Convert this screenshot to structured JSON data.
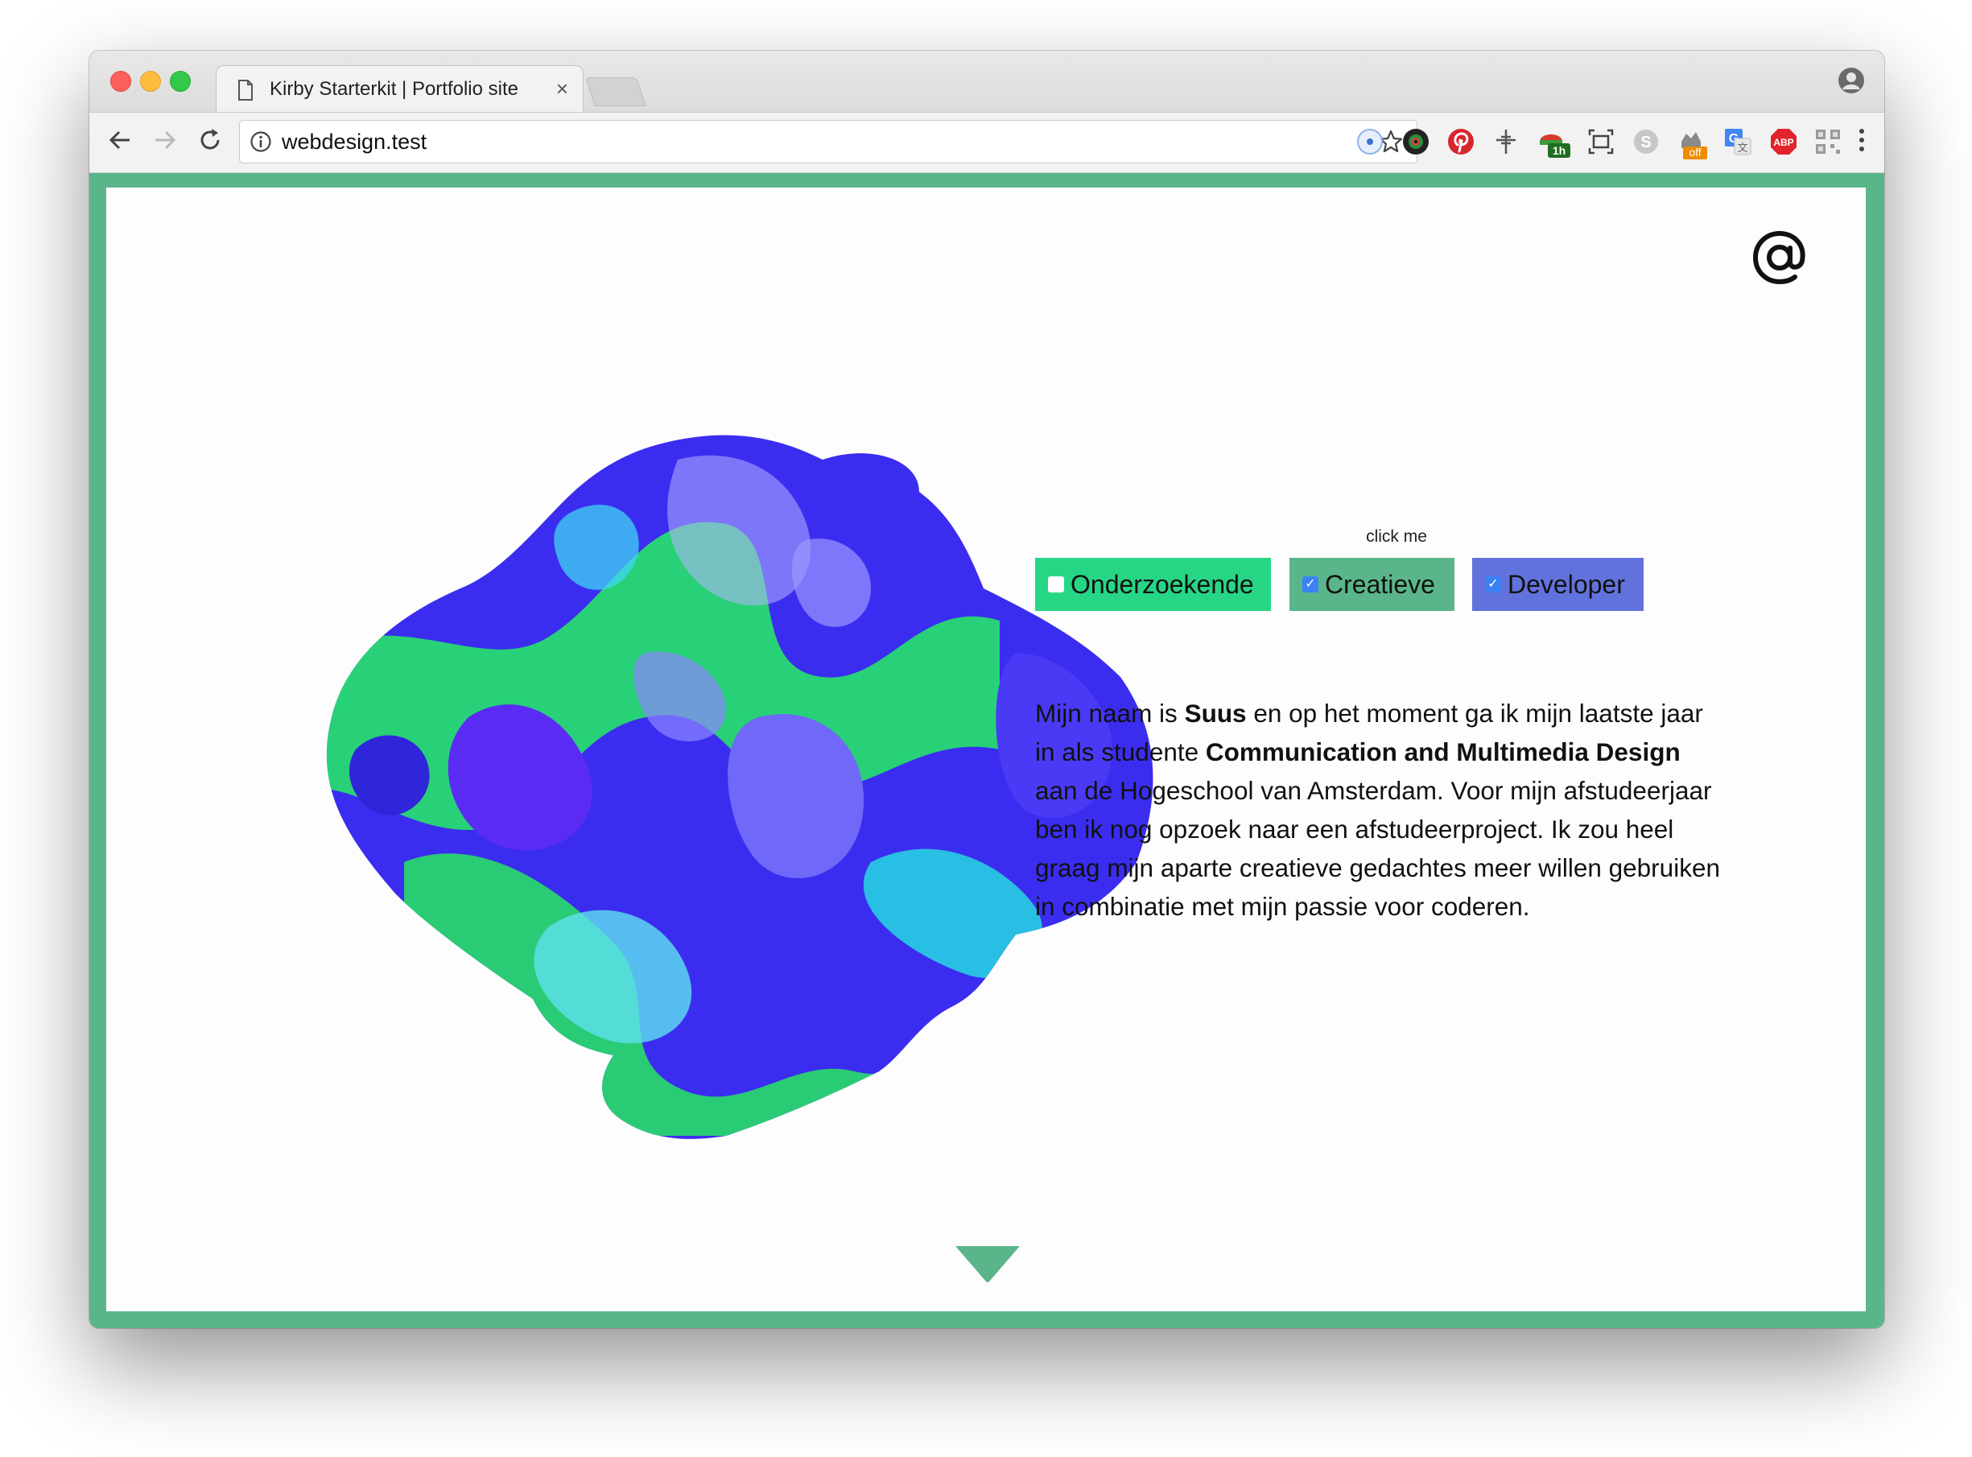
{
  "browser": {
    "tab_title": "Kirby Starterkit | Portfolio site",
    "tab_close": "×",
    "url": "webdesign.test",
    "extensions": [
      {
        "name": "color-picker-extension",
        "color": "#4a90e2"
      },
      {
        "name": "camera-extension",
        "color": "#222222"
      },
      {
        "name": "pinterest-extension",
        "color": "#d8262f"
      },
      {
        "name": "measure-extension",
        "color": "#555555"
      },
      {
        "name": "timer-extension",
        "badge": "1h",
        "color": "#d33b2c"
      },
      {
        "name": "screenshot-extension",
        "color": "#444444"
      },
      {
        "name": "skype-extension",
        "color": "#bbbbbb"
      },
      {
        "name": "sale-extension",
        "badge": "off",
        "color": "#f08c00"
      },
      {
        "name": "translate-extension",
        "color": "#4285f4"
      },
      {
        "name": "adblock-extension",
        "label": "ABP",
        "color": "#e0242b"
      },
      {
        "name": "qr-extension",
        "color": "#999999"
      }
    ]
  },
  "page": {
    "click_hint": "click me",
    "roles": [
      {
        "label": "Onderzoekende",
        "checked": false,
        "color": "#27d685"
      },
      {
        "label": "Creatieve",
        "checked": true,
        "color": "#5ab68a"
      },
      {
        "label": "Developer",
        "checked": true,
        "color": "#6272dc"
      }
    ],
    "check_mark": "✓",
    "bio": {
      "p1": "Mijn naam is ",
      "name": "Suus",
      "p2": " en op het moment ga ik mijn laatste jaar in als studente ",
      "study": "Communication and Multimedia Design",
      "p3": " aan de Hogeschool van Amsterdam. Voor mijn afstudeerjaar ben ik nog opzoek naar een afstudeerproject. Ik zou heel graag mijn aparte creatieve gedachtes meer willen gebruiken in combinatie met mijn passie voor coderen."
    },
    "accent_color": "#5ab68a"
  }
}
